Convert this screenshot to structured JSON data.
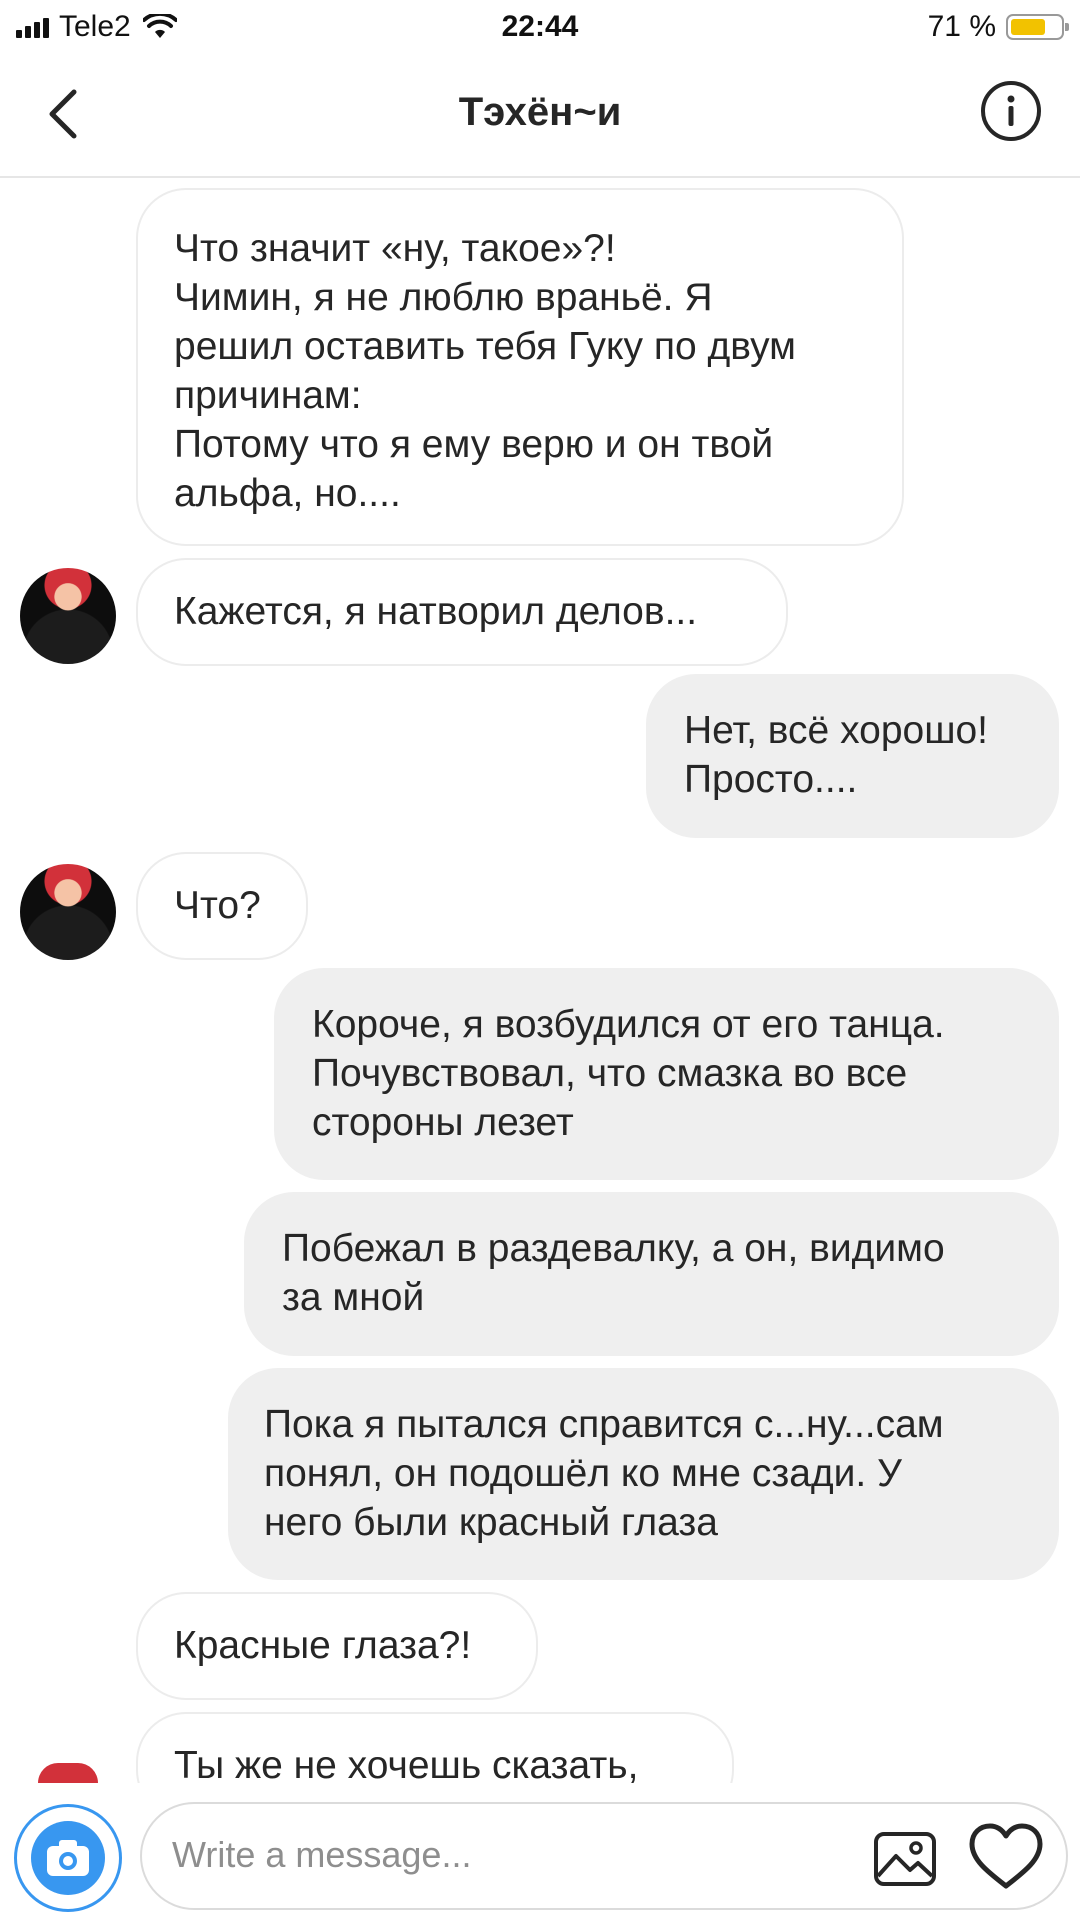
{
  "status_bar": {
    "carrier": "Tele2",
    "time": "22:44",
    "battery_text": "71 %",
    "battery_level": 0.71
  },
  "header": {
    "title": "Тэхён~и",
    "icons": {
      "back": "chevron-left-icon",
      "info": "info-icon"
    }
  },
  "messages": [
    {
      "direction": "in",
      "avatar": false,
      "text": "Что значит «ну, такое»?!\nЧимин, я не люблю враньё. Я\nрешил оставить тебя Гуку по двум\nпричинам:\nПотому что я ему верю и он твой\nальфа, но...."
    },
    {
      "direction": "in",
      "avatar": true,
      "text": "Кажется, я натворил делов..."
    },
    {
      "direction": "out",
      "avatar": false,
      "text": "Нет, всё хорошо!\nПросто...."
    },
    {
      "direction": "in",
      "avatar": true,
      "text": "Что?"
    },
    {
      "direction": "out",
      "avatar": false,
      "text": "Короче, я возбудился от его танца.\nПочувствовал, что смазка во все\nстороны лезет"
    },
    {
      "direction": "out",
      "avatar": false,
      "text": "Побежал в раздевалку, а он, видимо\nза мной"
    },
    {
      "direction": "out",
      "avatar": false,
      "text": "Пока я пытался справится с...ну...сам\nпонял, он подошёл ко мне сзади. У\nнего были красный глаза"
    },
    {
      "direction": "in",
      "avatar": false,
      "text": "Красные глаза?!"
    },
    {
      "direction": "in",
      "avatar": true,
      "text": "Ты же не хочешь сказать,"
    }
  ],
  "composer": {
    "placeholder": "Write a message...",
    "icons": {
      "camera": "camera-icon",
      "gallery": "gallery-icon",
      "like": "heart-icon"
    },
    "accent_color": "#3897f0"
  }
}
